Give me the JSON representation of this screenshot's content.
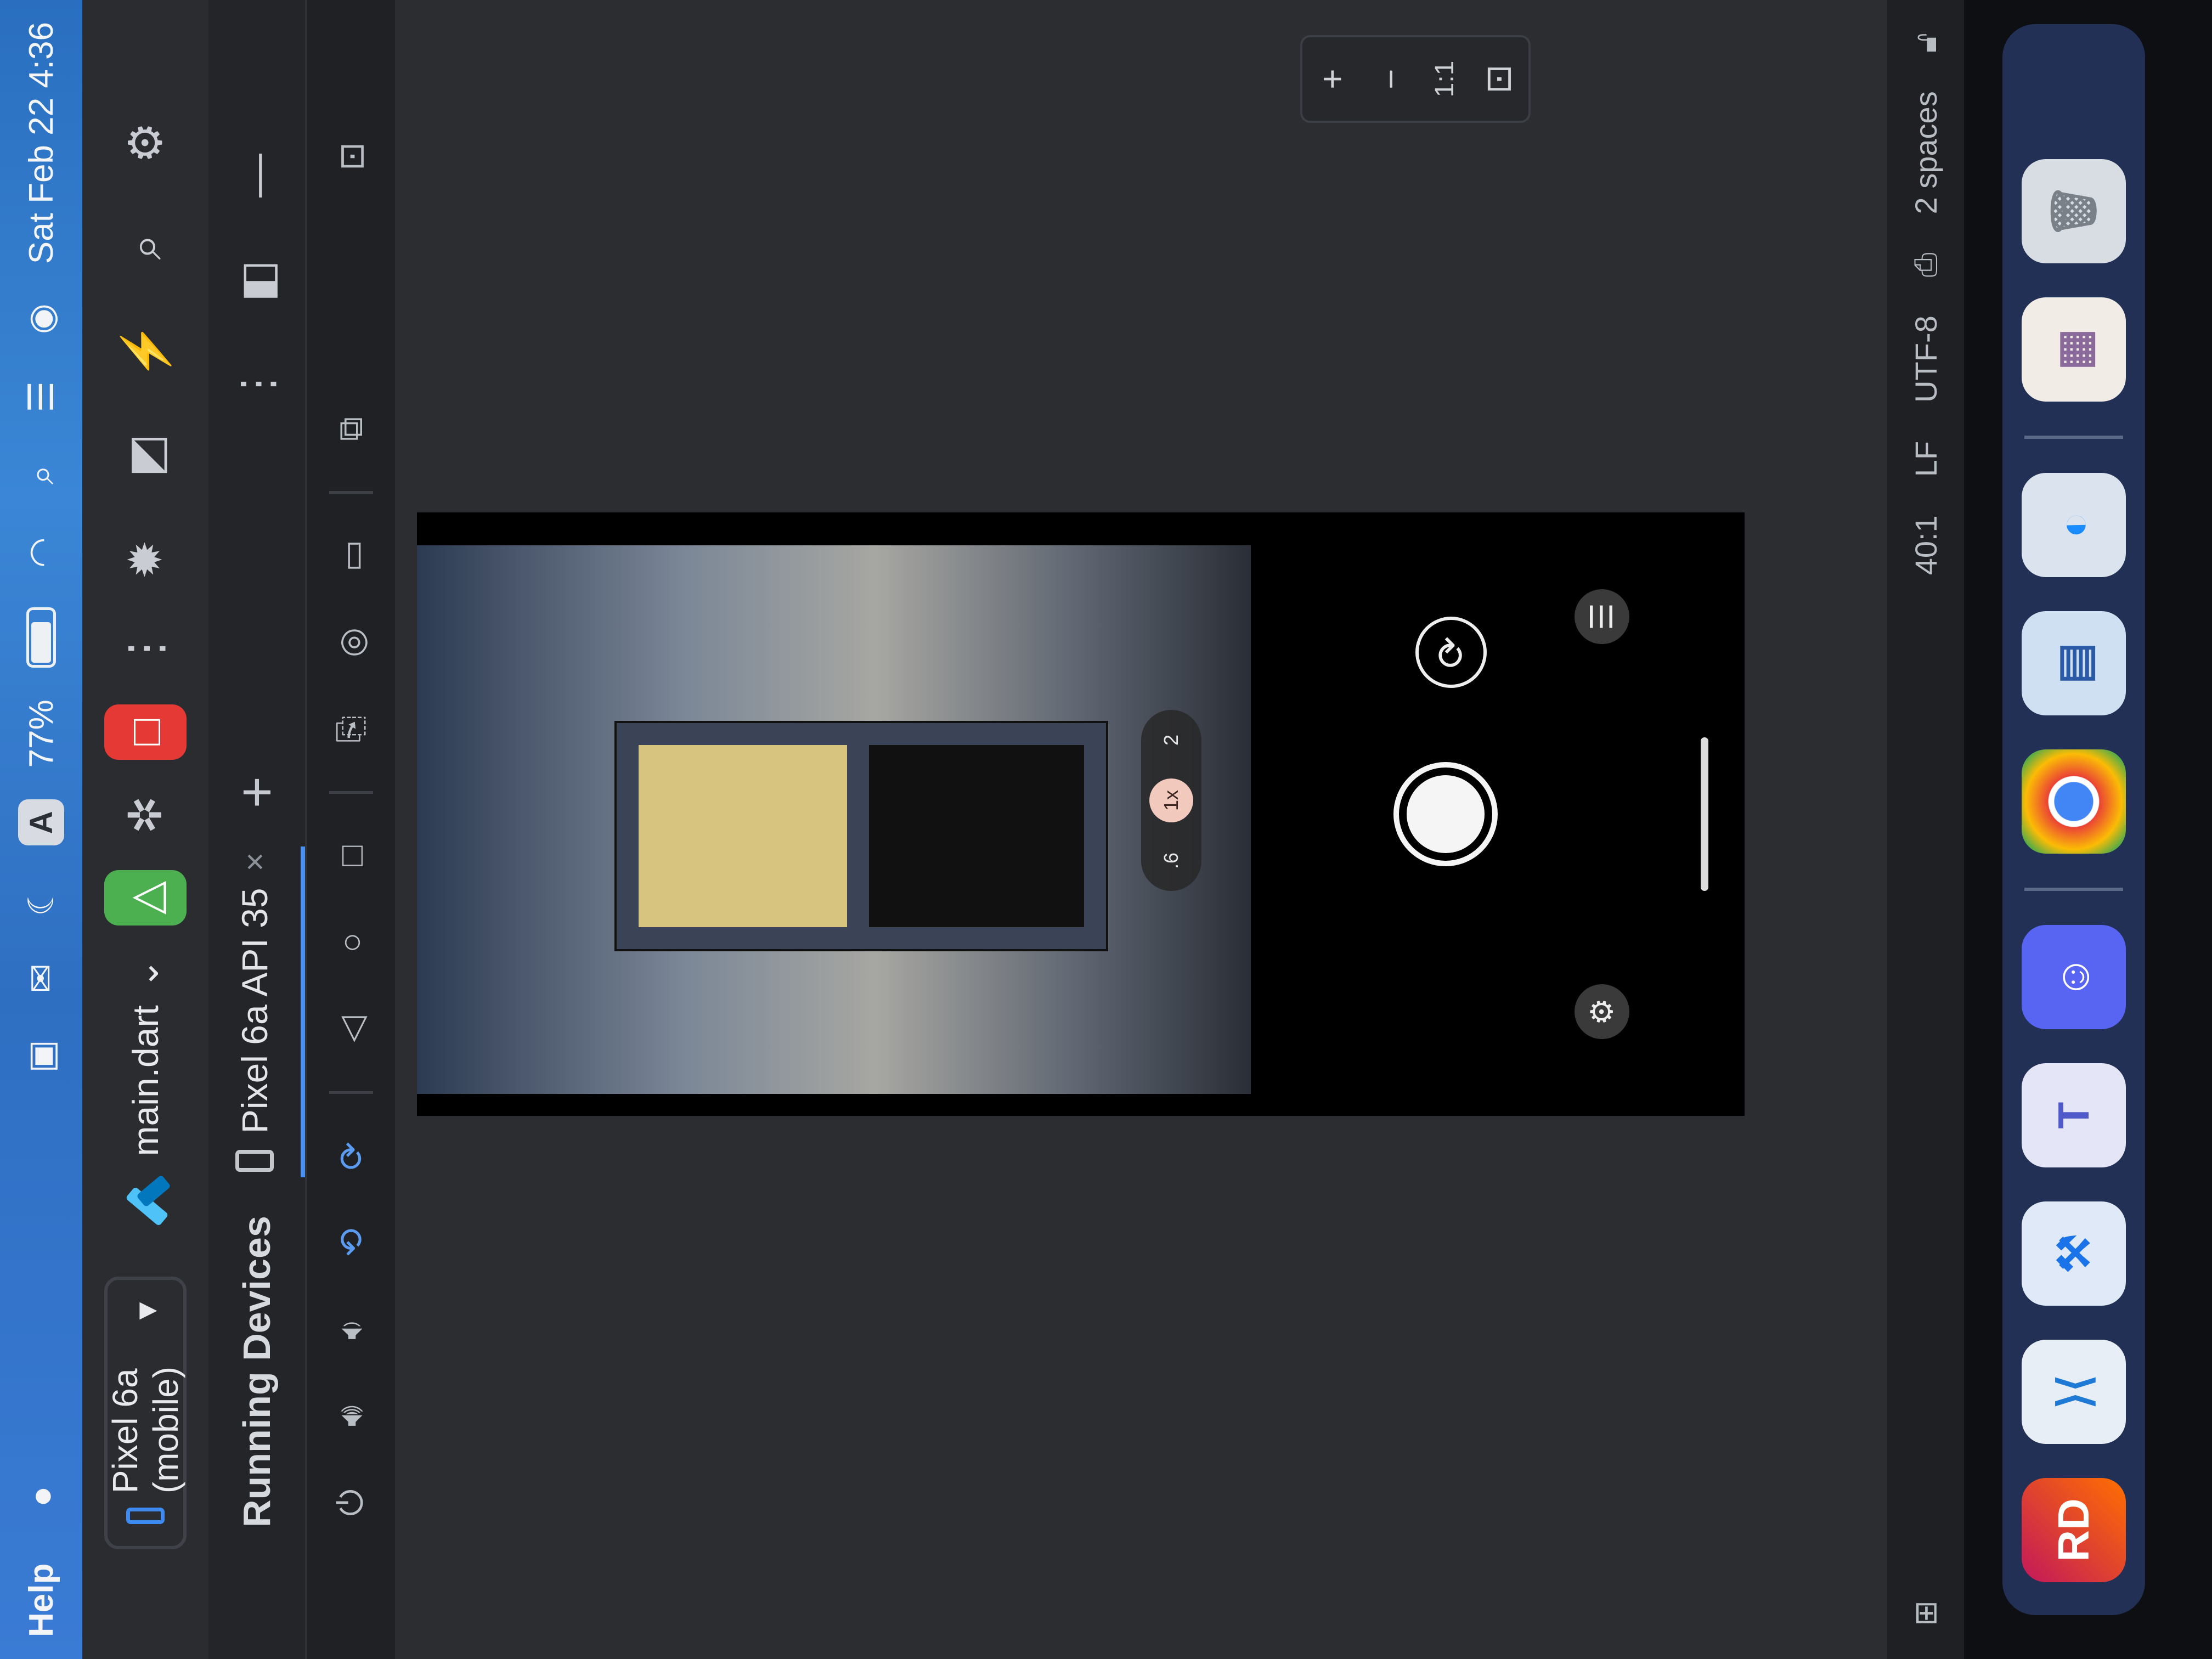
{
  "menubar": {
    "help": "Help",
    "battery": "77%",
    "input_source": "A",
    "date_time": "Sat Feb 22  4:36"
  },
  "toolbar": {
    "device": "Pixel 6a (mobile)",
    "run_config": "main.dart"
  },
  "tool_window": {
    "title": "Running Devices",
    "tab": "Pixel 6a API 35"
  },
  "camera": {
    "zoom_levels": [
      ".6",
      "1x",
      "2"
    ]
  },
  "zoom_panel": {
    "plus": "+",
    "ratio": "1:1"
  },
  "statusbar": {
    "position": "40:1",
    "line_sep": "LF",
    "encoding": "UTF-8",
    "indent": "2 spaces"
  },
  "dock": {
    "apps": [
      {
        "name": "rider-icon",
        "label": "RD"
      },
      {
        "name": "vscode-icon",
        "label": ""
      },
      {
        "name": "xcode-icon",
        "label": ""
      },
      {
        "name": "teams-icon",
        "label": "T"
      },
      {
        "name": "discord-icon",
        "label": ""
      },
      {
        "name": "chrome-icon",
        "label": ""
      },
      {
        "name": "preview-icon",
        "label": ""
      },
      {
        "name": "proxyman-icon",
        "label": ""
      },
      {
        "name": "document-icon",
        "label": ""
      },
      {
        "name": "trash-icon",
        "label": ""
      }
    ]
  },
  "colors": {
    "accent": "#4a8ef0",
    "run": "#4caf50",
    "stop": "#e53935"
  }
}
